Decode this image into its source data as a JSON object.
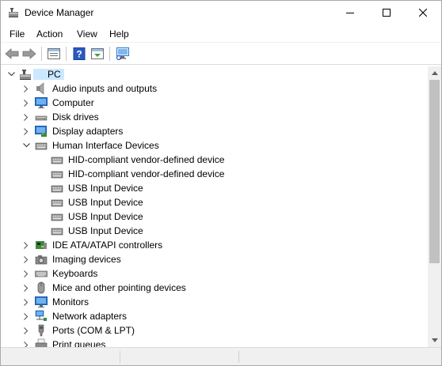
{
  "window": {
    "title": "Device Manager"
  },
  "menu": {
    "items": [
      "File",
      "Action",
      "View",
      "Help"
    ]
  },
  "toolbar": {
    "buttons": [
      "back-arrow-icon",
      "forward-arrow-icon",
      "properties-icon",
      "help-icon",
      "driver-update-icon",
      "monitor-scan-icon"
    ]
  },
  "tree": {
    "root": {
      "label": "PC",
      "expanded": true,
      "selected": true
    },
    "nodes": [
      {
        "label": "Audio inputs and outputs",
        "icon": "speaker-icon",
        "expanded": false,
        "level": 1
      },
      {
        "label": "Computer",
        "icon": "computer-icon",
        "expanded": false,
        "level": 1
      },
      {
        "label": "Disk drives",
        "icon": "disk-drive-icon",
        "expanded": false,
        "level": 1
      },
      {
        "label": "Display adapters",
        "icon": "display-adapter-icon",
        "expanded": false,
        "level": 1
      },
      {
        "label": "Human Interface Devices",
        "icon": "hid-icon",
        "expanded": true,
        "level": 1
      },
      {
        "label": "HID-compliant vendor-defined device",
        "icon": "hid-icon",
        "level": 2
      },
      {
        "label": "HID-compliant vendor-defined device",
        "icon": "hid-icon",
        "level": 2
      },
      {
        "label": "USB Input Device",
        "icon": "hid-icon",
        "level": 2
      },
      {
        "label": "USB Input Device",
        "icon": "hid-icon",
        "level": 2
      },
      {
        "label": "USB Input Device",
        "icon": "hid-icon",
        "level": 2
      },
      {
        "label": "USB Input Device",
        "icon": "hid-icon",
        "level": 2
      },
      {
        "label": "IDE ATA/ATAPI controllers",
        "icon": "ide-controller-icon",
        "expanded": false,
        "level": 1
      },
      {
        "label": "Imaging devices",
        "icon": "camera-icon",
        "expanded": false,
        "level": 1
      },
      {
        "label": "Keyboards",
        "icon": "keyboard-icon",
        "expanded": false,
        "level": 1
      },
      {
        "label": "Mice and other pointing devices",
        "icon": "mouse-icon",
        "expanded": false,
        "level": 1
      },
      {
        "label": "Monitors",
        "icon": "monitor-icon",
        "expanded": false,
        "level": 1
      },
      {
        "label": "Network adapters",
        "icon": "network-adapter-icon",
        "expanded": false,
        "level": 1
      },
      {
        "label": "Ports (COM & LPT)",
        "icon": "port-icon",
        "expanded": false,
        "level": 1
      },
      {
        "label": "Print queues",
        "icon": "printer-icon",
        "expanded": false,
        "level": 1
      }
    ]
  },
  "colors": {
    "selection": "#cce8ff",
    "icon_blue": "#2b78d0",
    "icon_gray": "#6e6e6e"
  }
}
